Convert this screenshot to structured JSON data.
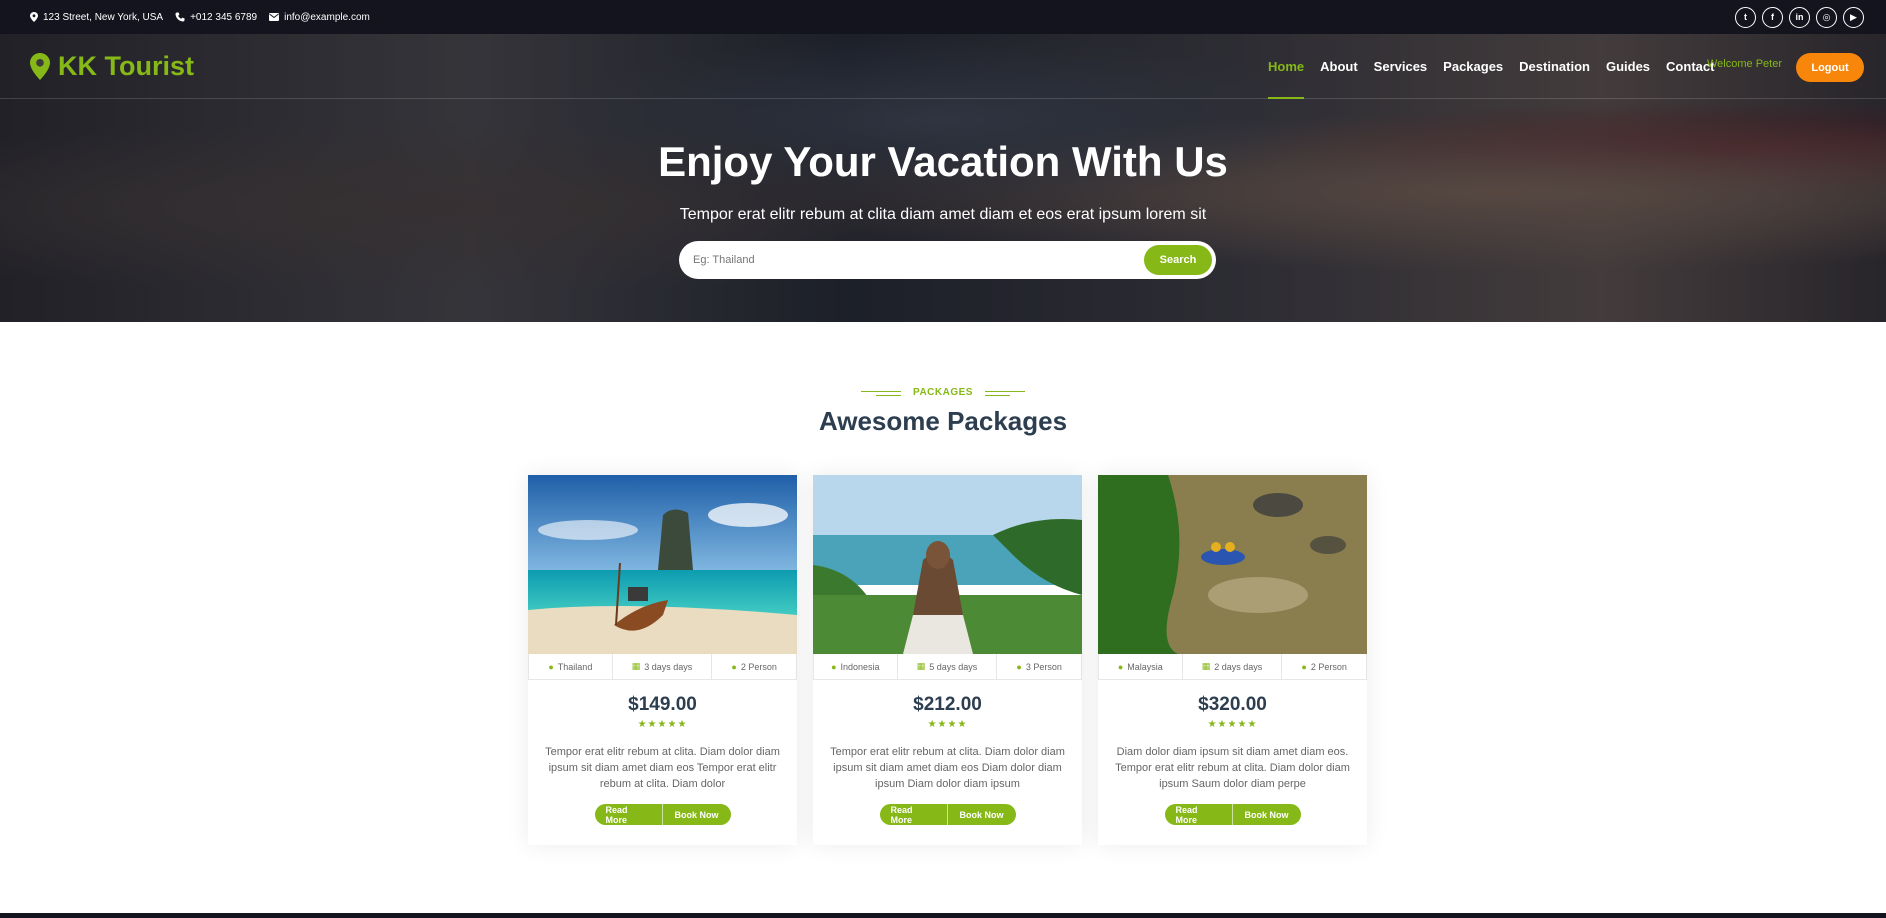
{
  "topbar": {
    "address": "123 Street, New York, USA",
    "phone": "+012 345 6789",
    "email": "info@example.com",
    "social": [
      {
        "icon": "twitter-icon",
        "glyph": "t"
      },
      {
        "icon": "facebook-icon",
        "glyph": "f"
      },
      {
        "icon": "linkedin-icon",
        "glyph": "in"
      },
      {
        "icon": "instagram-icon",
        "glyph": "◎"
      },
      {
        "icon": "youtube-icon",
        "glyph": "▶"
      }
    ]
  },
  "nav": {
    "brand": "KK Tourist",
    "items": [
      "Home",
      "About",
      "Services",
      "Packages",
      "Destination",
      "Guides",
      "Contact"
    ],
    "active": "Home",
    "welcome": "Welcome Peter",
    "logout": "Logout"
  },
  "hero": {
    "title": "Enjoy Your Vacation With Us",
    "subtitle": "Tempor erat elitr rebum at clita diam amet diam et eos erat ipsum lorem sit",
    "search_placeholder": "Eg: Thailand",
    "search_button": "Search"
  },
  "section": {
    "tag": "PACKAGES",
    "title": "Awesome Packages"
  },
  "packages": [
    {
      "location": "Thailand",
      "duration": "3 days days",
      "persons": "2 Person",
      "price": "$149.00",
      "rating": 5,
      "stars": "★★★★★",
      "description": "Tempor erat elitr rebum at clita. Diam dolor diam ipsum sit diam amet diam eos Tempor erat elitr rebum at clita. Diam dolor",
      "read_more": "Read More",
      "book_now": "Book Now"
    },
    {
      "location": "Indonesia",
      "duration": "5 days days",
      "persons": "3 Person",
      "price": "$212.00",
      "rating": 4,
      "stars": "★★★★",
      "description": "Tempor erat elitr rebum at clita. Diam dolor diam ipsum sit diam amet diam eos Diam dolor diam ipsum Diam dolor diam ipsum",
      "read_more": "Read More",
      "book_now": "Book Now"
    },
    {
      "location": "Malaysia",
      "duration": "2 days days",
      "persons": "2 Person",
      "price": "$320.00",
      "rating": 5,
      "stars": "★★★★★",
      "description": "Diam dolor diam ipsum sit diam amet diam eos. Tempor erat elitr rebum at clita. Diam dolor diam ipsum Saum dolor diam perpe",
      "read_more": "Read More",
      "book_now": "Book Now"
    }
  ],
  "colors": {
    "accent": "#86b817",
    "logout": "#f7860b",
    "dark": "#14141f",
    "heading": "#2c3e50"
  }
}
